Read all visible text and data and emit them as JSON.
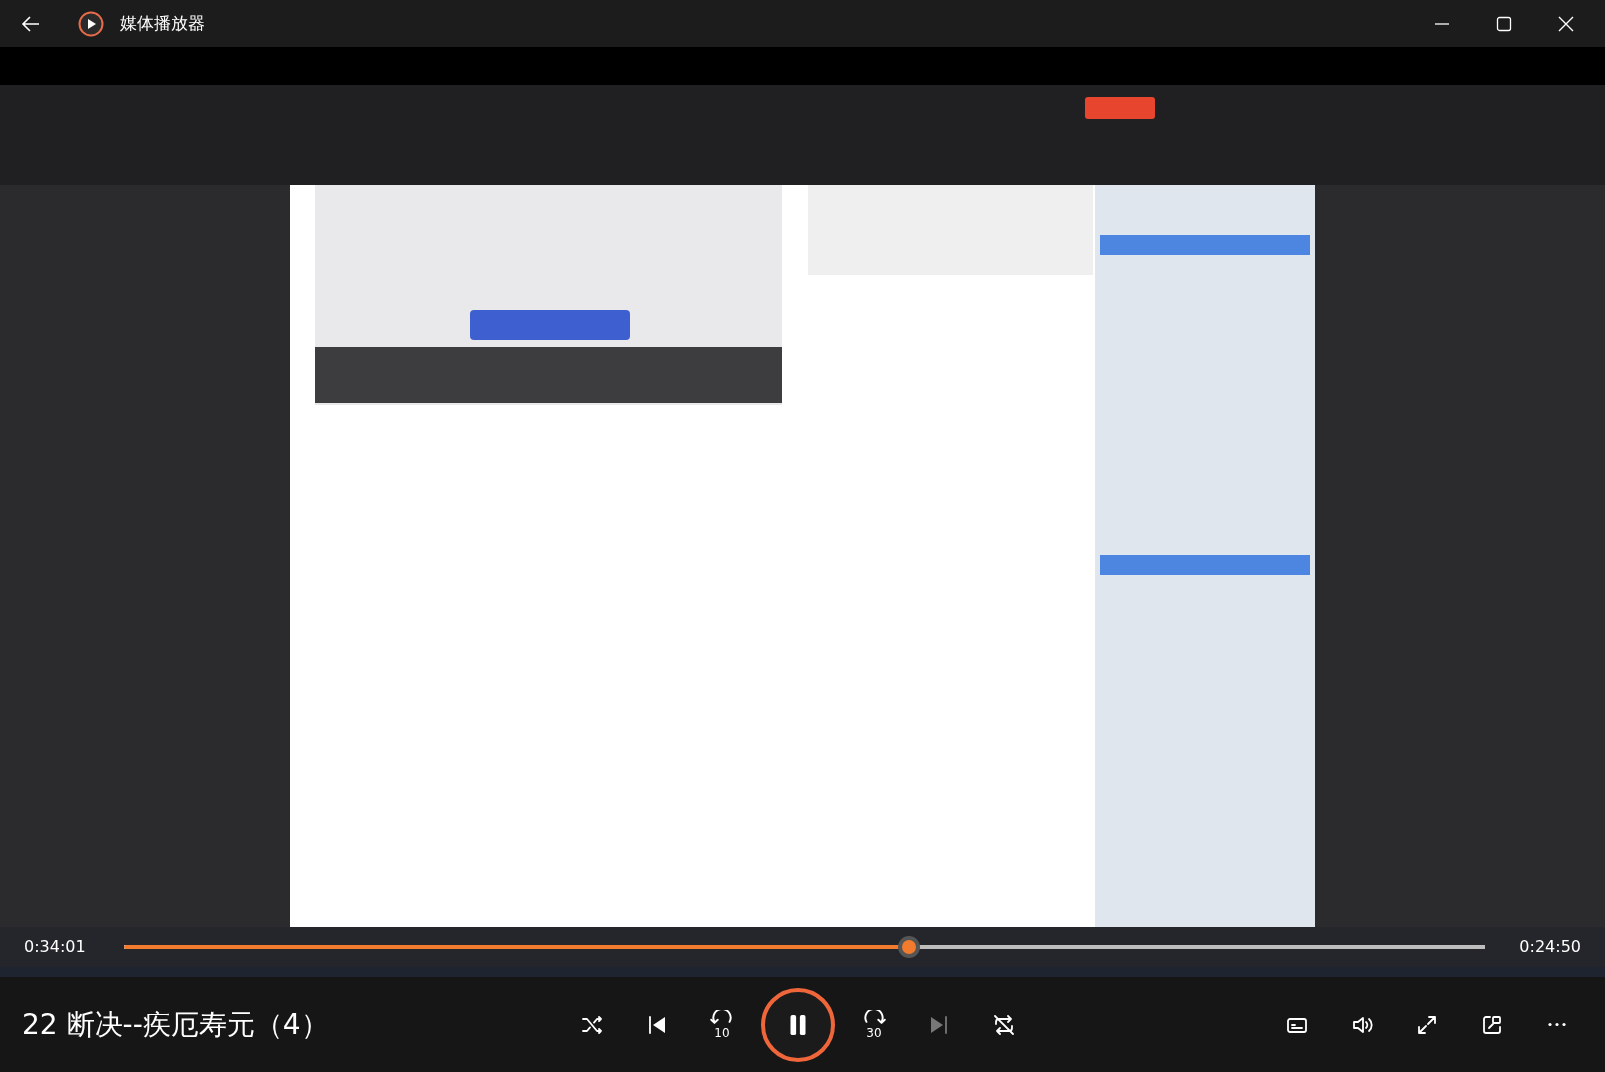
{
  "window": {
    "title": "媒体播放器"
  },
  "playback": {
    "elapsed": "0:34:01",
    "remaining": "0:24:50",
    "level": 0.577
  },
  "now_playing": {
    "title": "22 断决--疾厄寿元（4）"
  },
  "controls": [
    {
      "kind": "shuffle",
      "disabled": false
    },
    {
      "kind": "previous",
      "disabled": false
    },
    {
      "kind": "rewind",
      "label": "10",
      "disabled": false
    },
    {
      "kind": "pause",
      "disabled": false
    },
    {
      "kind": "forward",
      "label": "30",
      "disabled": false
    },
    {
      "kind": "next",
      "disabled": true
    },
    {
      "kind": "repeat",
      "disabled": false
    }
  ],
  "tools": [
    {
      "kind": "subtitles"
    },
    {
      "kind": "volume"
    },
    {
      "kind": "fullscreen"
    },
    {
      "kind": "miniplayer"
    },
    {
      "kind": "more"
    }
  ]
}
